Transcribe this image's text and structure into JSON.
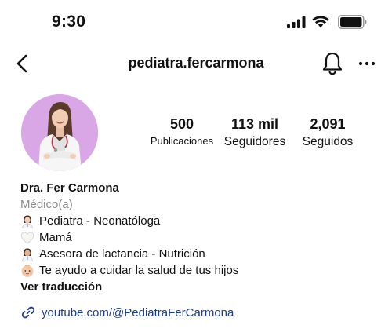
{
  "status_bar": {
    "time": "9:30",
    "icons": [
      "cellular-signal-icon",
      "wifi-icon",
      "battery-icon"
    ]
  },
  "nav": {
    "handle": "pediatra.fercarmona",
    "icons": [
      "chevron-left-icon",
      "bell-icon",
      "more-horizontal-icon"
    ]
  },
  "stats": [
    {
      "count": "500",
      "label": "Publicaciones"
    },
    {
      "count": "113 mil",
      "label": "Seguidores"
    },
    {
      "count": "2,091",
      "label": "Seguidos"
    }
  ],
  "bio": {
    "name": "Dra. Fer Carmona",
    "category": "Médico(a)",
    "lines": [
      {
        "icon": "woman-health-worker-emoji",
        "text": "Pediatra - Neonatóloga"
      },
      {
        "icon": "white-heart-emoji",
        "text": "Mamá"
      },
      {
        "icon": "woman-health-worker-emoji",
        "text": "Asesora de lactancia - Nutrición"
      },
      {
        "icon": "baby-emoji",
        "text": "Te ayudo a cuidar la salud de tus hijos"
      }
    ],
    "translate_label": "Ver traducción"
  },
  "link": {
    "text": "youtube.com/@PediatraFerCarmona",
    "icon": "link-icon"
  },
  "colors": {
    "link": "#1c3d87",
    "secondary_text": "#8a8a8a",
    "avatar_background": "#d9a7e6"
  }
}
